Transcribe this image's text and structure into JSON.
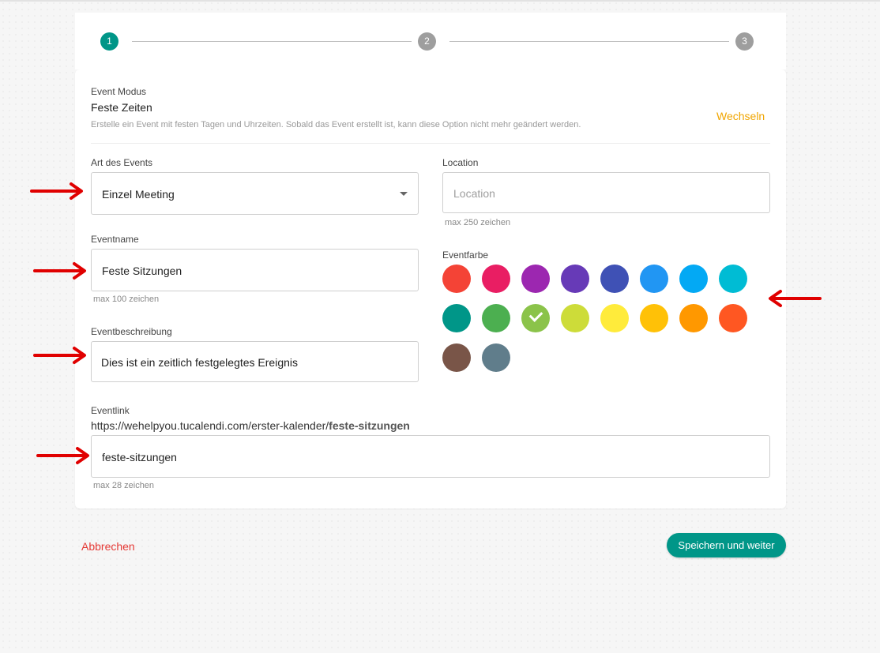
{
  "stepper": {
    "steps": [
      {
        "label": "1",
        "color": "#009688"
      },
      {
        "label": "2",
        "color": "#9e9e9e"
      },
      {
        "label": "3",
        "color": "#9e9e9e"
      }
    ]
  },
  "mode": {
    "label": "Event Modus",
    "value": "Feste Zeiten",
    "description": "Erstelle ein Event mit festen Tagen und Uhrzeiten. Sobald das Event erstellt ist, kann diese Option nicht mehr geändert werden.",
    "switch_label": "Wechseln"
  },
  "event_type": {
    "label": "Art des Events",
    "value": "Einzel Meeting"
  },
  "location": {
    "label": "Location",
    "placeholder": "Location",
    "hint": "max 250 zeichen"
  },
  "event_name": {
    "label": "Eventname",
    "value": "Feste Sitzungen",
    "hint": "max 100 zeichen"
  },
  "event_description": {
    "label": "Eventbeschreibung",
    "value": "Dies ist ein zeitlich festgelegtes Ereignis"
  },
  "event_color": {
    "label": "Eventfarbe",
    "selected": "#8bc34a",
    "colors": [
      "#f44336",
      "#e91e63",
      "#9c27b0",
      "#673ab7",
      "#3f51b5",
      "#2196f3",
      "#03a9f4",
      "#00bcd4",
      "#009688",
      "#4caf50",
      "#8bc34a",
      "#cddc39",
      "#ffeb3b",
      "#ffc107",
      "#ff9800",
      "#ff5722",
      "#795548",
      "#607d8b"
    ]
  },
  "event_link": {
    "label": "Eventlink",
    "url_base": "https://wehelpyou.tucalendi.com/erster-kalender/",
    "url_slug": "feste-sitzungen",
    "value": "feste-sitzungen",
    "hint": "max 28 zeichen"
  },
  "footer": {
    "cancel_label": "Abbrechen",
    "save_label": "Speichern und weiter"
  },
  "colors": {
    "accent": "#009688",
    "switch": "#f0a500",
    "cancel": "#e53935",
    "annotation_arrow": "#e00000"
  }
}
